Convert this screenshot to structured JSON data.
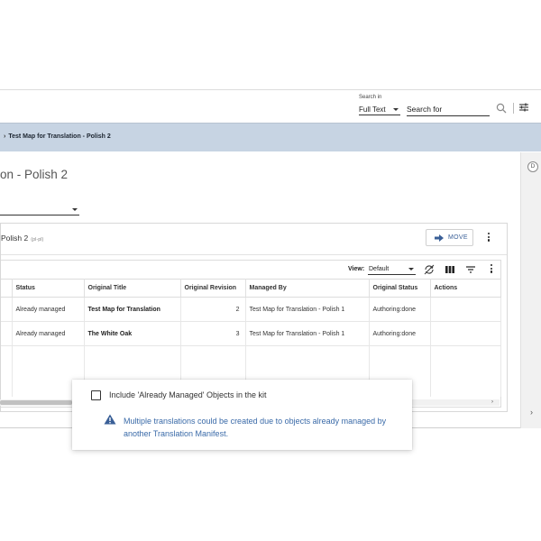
{
  "topbar": {
    "search_in_label": "Search in",
    "search_in_value": "Full Text",
    "search_placeholder": "Search for"
  },
  "breadcrumb": {
    "current": "Test Map for Translation - Polish 2"
  },
  "page": {
    "title": "on - Polish 2"
  },
  "rail": {
    "badge": "D"
  },
  "card": {
    "language_title": "Polish 2",
    "language_code": "(pl-pl)",
    "move_label": "MOVE"
  },
  "grid": {
    "view_label": "View:",
    "view_value": "Default",
    "columns": [
      "Status",
      "Original Title",
      "Original Revision",
      "Managed By",
      "Original Status",
      "Actions"
    ],
    "rows": [
      {
        "status": "Already managed",
        "original_title": "Test Map for Translation",
        "original_revision": "2",
        "managed_by": "Test Map for Translation - Polish 1",
        "original_status": "Authoring:done",
        "actions": ""
      },
      {
        "status": "Already managed",
        "original_title": "The White Oak",
        "original_revision": "3",
        "managed_by": "Test Map for Translation - Polish 1",
        "original_status": "Authoring:done",
        "actions": ""
      }
    ]
  },
  "callout": {
    "checkbox_label": "Include 'Already Managed' Objects in the kit",
    "checkbox_checked": false,
    "warning_text": "Multiple translations could be created due to objects already managed by another Translation Manifest.",
    "warning_color": "#3a6aa8"
  },
  "colors": {
    "breadcrumb_band": "#c7d4e3",
    "accent": "#3a5f97"
  }
}
